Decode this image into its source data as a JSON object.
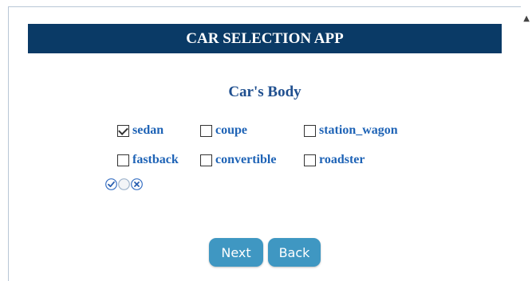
{
  "header": {
    "title": "CAR SELECTION APP"
  },
  "section": {
    "title": "Car's Body"
  },
  "options": [
    {
      "label": "sedan",
      "checked": true
    },
    {
      "label": "coupe",
      "checked": false
    },
    {
      "label": "station_wagon",
      "checked": false
    },
    {
      "label": "fastback",
      "checked": false
    },
    {
      "label": "convertible",
      "checked": false
    },
    {
      "label": "roadster",
      "checked": false
    }
  ],
  "selection_icons": [
    "check-all-icon",
    "clear-icon",
    "cancel-icon"
  ],
  "buttons": {
    "next": "Next",
    "back": "Back"
  },
  "colors": {
    "header_bg": "#0a3a66",
    "label": "#1e63b6",
    "button_bg": "#3f97c2"
  }
}
